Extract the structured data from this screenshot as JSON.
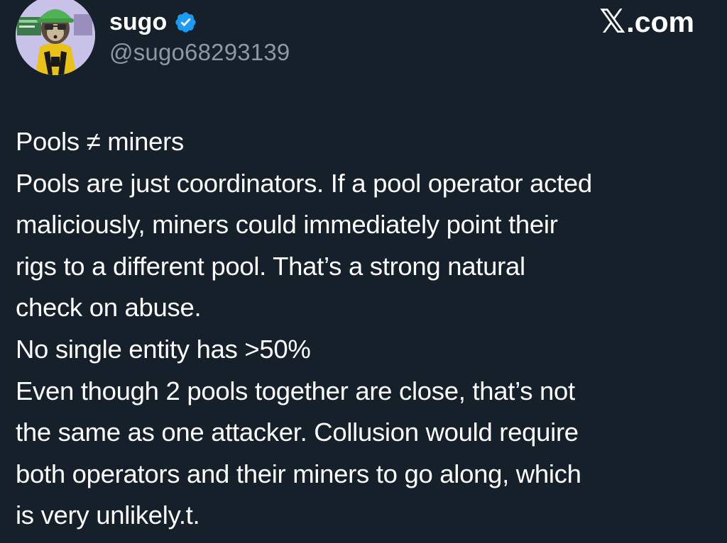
{
  "author": {
    "display_name": "sugo",
    "handle": "@sugo68293139",
    "verified": true
  },
  "site": {
    "logo_icon": "x-logo-icon",
    "logo_glyph": "𝕏",
    "label": ".com"
  },
  "colors": {
    "background": "#15202b",
    "text": "#ffffff",
    "handle": "#8b98a5",
    "verified_badge": "#1d9bf0"
  },
  "body_lines": [
    "Pools ≠ miners",
    "Pools are just coordinators. If a pool operator acted",
    "maliciously, miners could immediately point their",
    "rigs to a different pool. That’s a strong natural",
    "check on abuse.",
    "No single entity has >50%",
    "Even though 2 pools together are close, that’s not",
    "the same as one attacker. Collusion would require",
    "both operators and their miners to go along, which",
    "is very unlikely.t."
  ]
}
